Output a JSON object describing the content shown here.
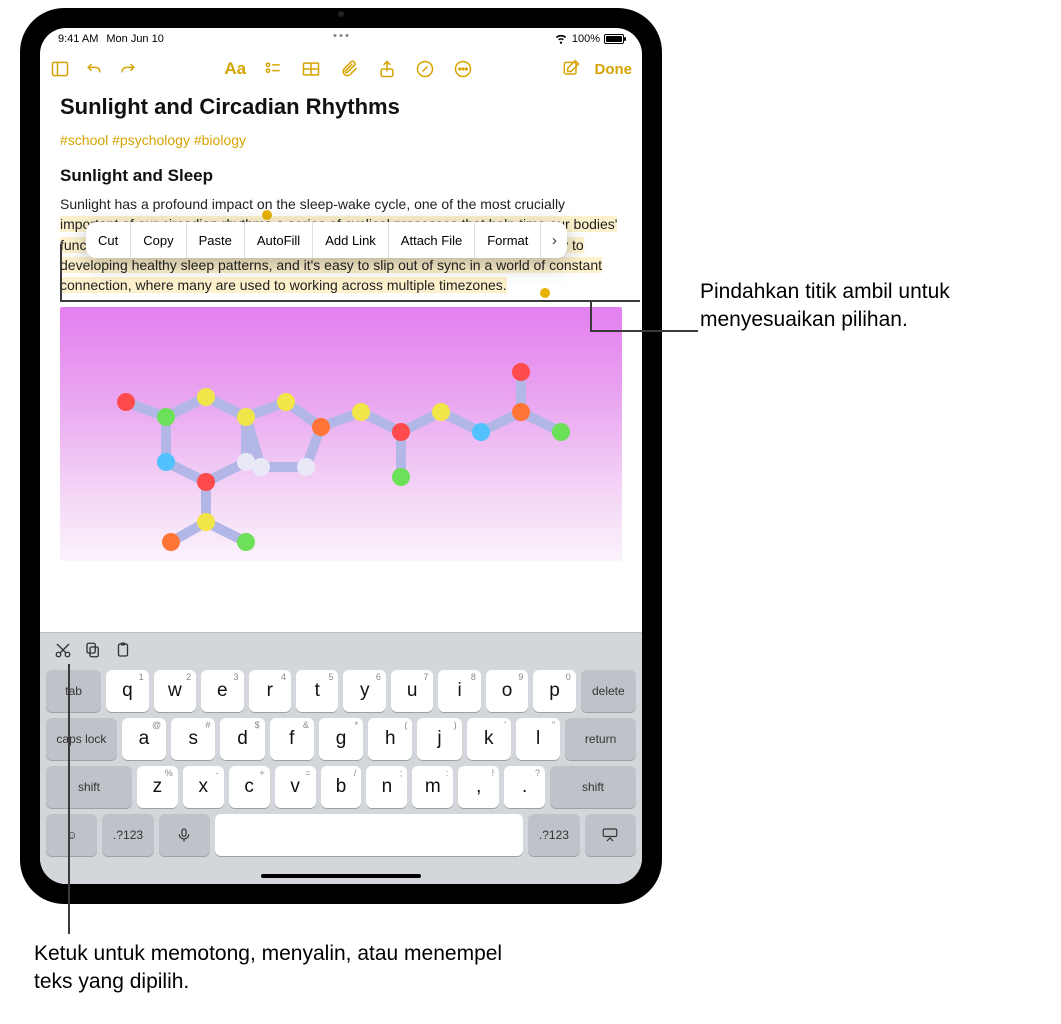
{
  "status": {
    "time": "9:41 AM",
    "date": "Mon Jun 10",
    "battery_pct": "100%"
  },
  "toolbar": {
    "done": "Done"
  },
  "note": {
    "title": "Sunlight and Circadian Rhythms",
    "tags": "#school #psychology #biology",
    "subheading": "Sunlight and Sleep",
    "p_prefix": "Sunlight has a profound impact on the sleep-wake cycle, one of the most crucially ",
    "p_highlighted": "important of our circadian rhythms-a series of cyclical processes that help time our bodies' functions to optimize everything from wakefulness to digestion. Consistency is key to developing healthy sleep patterns, and it's easy to slip out of sync in a world of constant connection, where many are used to working across multiple timezones."
  },
  "context_menu": {
    "cut": "Cut",
    "copy": "Copy",
    "paste": "Paste",
    "autofill": "AutoFill",
    "addlink": "Add Link",
    "attachfile": "Attach File",
    "format": "Format"
  },
  "keyboard": {
    "row1": [
      {
        "main": "q",
        "sub": "1"
      },
      {
        "main": "w",
        "sub": "2"
      },
      {
        "main": "e",
        "sub": "3"
      },
      {
        "main": "r",
        "sub": "4"
      },
      {
        "main": "t",
        "sub": "5"
      },
      {
        "main": "y",
        "sub": "6"
      },
      {
        "main": "u",
        "sub": "7"
      },
      {
        "main": "i",
        "sub": "8"
      },
      {
        "main": "o",
        "sub": "9"
      },
      {
        "main": "p",
        "sub": "0"
      }
    ],
    "row2": [
      {
        "main": "a",
        "sub": "@"
      },
      {
        "main": "s",
        "sub": "#"
      },
      {
        "main": "d",
        "sub": "$"
      },
      {
        "main": "f",
        "sub": "&"
      },
      {
        "main": "g",
        "sub": "*"
      },
      {
        "main": "h",
        "sub": "("
      },
      {
        "main": "j",
        "sub": ")"
      },
      {
        "main": "k",
        "sub": "'"
      },
      {
        "main": "l",
        "sub": "\""
      }
    ],
    "row3": [
      {
        "main": "z",
        "sub": "%"
      },
      {
        "main": "x",
        "sub": "-"
      },
      {
        "main": "c",
        "sub": "+"
      },
      {
        "main": "v",
        "sub": "="
      },
      {
        "main": "b",
        "sub": "/"
      },
      {
        "main": "n",
        "sub": ";"
      },
      {
        "main": "m",
        "sub": ":"
      },
      {
        "main": ",",
        "sub": "!"
      },
      {
        "main": ".",
        "sub": "?"
      }
    ],
    "tab": "tab",
    "delete": "delete",
    "capslock": "caps lock",
    "return": "return",
    "shift": "shift",
    "numkey": ".?123"
  },
  "callouts": {
    "right": "Pindahkan titik ambil untuk menyesuaikan pilihan.",
    "bottom": "Ketuk untuk memotong, menyalin, atau menempel teks yang dipilih."
  }
}
